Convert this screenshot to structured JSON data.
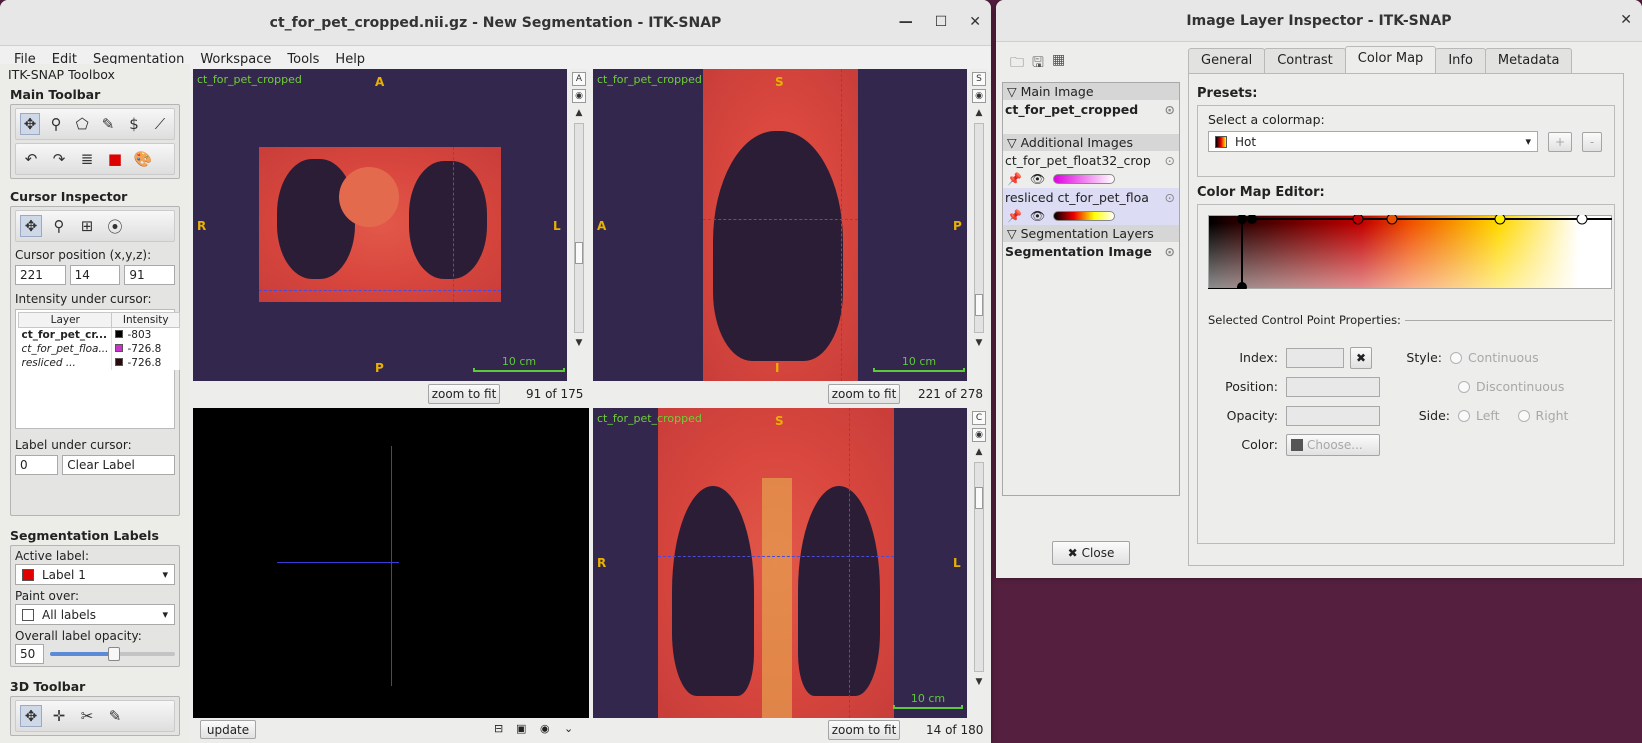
{
  "main": {
    "title": "ct_for_pet_cropped.nii.gz - New Segmentation - ITK-SNAP",
    "menu": [
      "File",
      "Edit",
      "Segmentation",
      "Workspace",
      "Tools",
      "Help"
    ],
    "toolbox_title": "ITK-SNAP Toolbox",
    "main_toolbar": "Main Toolbar",
    "cursor_inspector": "Cursor Inspector",
    "cursor_position_label": "Cursor position (x,y,z):",
    "cursor": {
      "x": "221",
      "y": "14",
      "z": "91"
    },
    "intensity_label": "Intensity under cursor:",
    "layer_header": "Layer",
    "intensity_header": "Intensity",
    "layers": [
      {
        "name": "ct_for_pet_cr...",
        "value": "-803",
        "color": "#000000"
      },
      {
        "name": "ct_for_pet_floa...",
        "value": "-726.8",
        "color": "#cc33cc"
      },
      {
        "name": "resliced ...",
        "value": "-726.8",
        "color": "#2a0a0a"
      }
    ],
    "label_under_cursor": "Label under cursor:",
    "label_value": "0",
    "label_name": "Clear Label",
    "seg_labels": "Segmentation Labels",
    "active_label_label": "Active label:",
    "active_label": "Label 1",
    "active_color": "#e00000",
    "paint_over_label": "Paint over:",
    "paint_over": "All labels",
    "opacity_label": "Overall label opacity:",
    "opacity": "50",
    "opacity_level": 0.5,
    "toolbar3d": "3D Toolbar"
  },
  "views": {
    "axial": {
      "layer": "ct_for_pet_cropped",
      "top": "A",
      "bottom": "P",
      "left": "R",
      "right": "L",
      "scale": "10 cm",
      "slice": "91 of 175",
      "zoom": "zoom to fit"
    },
    "sagittal": {
      "layer": "ct_for_pet_cropped",
      "top": "S",
      "bottom": "I",
      "left": "A",
      "right": "P",
      "scale": "10 cm",
      "slice": "221 of 278",
      "zoom": "zoom to fit"
    },
    "coronal": {
      "layer": "ct_for_pet_cropped",
      "top": "S",
      "left": "R",
      "right": "L",
      "scale": "10 cm",
      "slice": "14 of 180",
      "zoom": "zoom to fit"
    },
    "render3d": {
      "update": "update"
    }
  },
  "inspector": {
    "title": "Image Layer Inspector - ITK-SNAP",
    "tabs": [
      "General",
      "Contrast",
      "Color Map",
      "Info",
      "Metadata"
    ],
    "main_image_group": "Main Image",
    "main_image": "ct_for_pet_cropped",
    "additional_group": "Additional Images",
    "additional": [
      "ct_for_pet_float32_crop",
      "resliced ct_for_pet_floa"
    ],
    "seg_group": "Segmentation Layers",
    "seg_layer": "Segmentation Image",
    "close": "Close",
    "presets": "Presets:",
    "select_colormap": "Select a colormap:",
    "colormap": "Hot",
    "plus": "+",
    "minus": "-",
    "editor": "Color Map Editor:",
    "selected_props": "Selected Control Point Properties:",
    "index_label": "Index:",
    "position_label": "Position:",
    "opacity_label": "Opacity:",
    "color_label": "Color:",
    "choose": "Choose...",
    "style_label": "Style:",
    "continuous": "Continuous",
    "discontinuous": "Discontinuous",
    "side_label": "Side:",
    "left": "Left",
    "right": "Right"
  }
}
